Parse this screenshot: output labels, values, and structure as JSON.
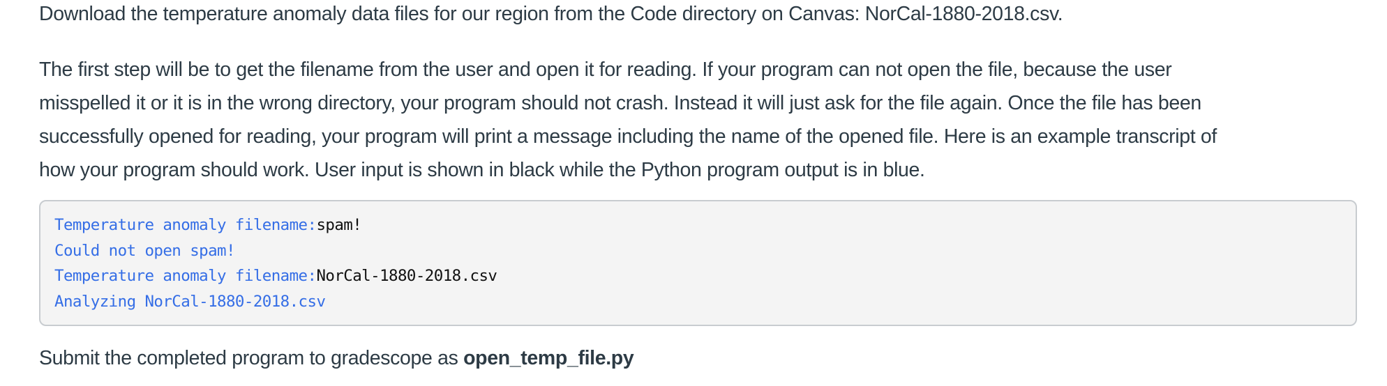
{
  "intro": "Download the temperature anomaly data files for our region from the Code directory on Canvas: NorCal-1880-2018.csv.",
  "instructions_lines": [
    "The first step will be to get the filename from the user and open it for reading. If your program can not open the file, because the user",
    "misspelled it or it is in the wrong directory, your program should not crash. Instead it will just ask for the file again. Once the file has been",
    "successfully opened for reading, your program will print a message including the name of the opened file. Here is an example transcript of",
    "how your program should work. User input is shown in black while the Python program output is in blue."
  ],
  "transcript": [
    {
      "output": "Temperature anomaly filename:",
      "input": "spam!"
    },
    {
      "output": "Could not open spam!",
      "input": ""
    },
    {
      "output": "Temperature anomaly filename:",
      "input": "NorCal-1880-2018.csv"
    },
    {
      "output": "Analyzing NorCal-1880-2018.csv",
      "input": ""
    }
  ],
  "submit": {
    "text": "Submit the completed program to gradescope as ",
    "filename": "open_temp_file.py"
  },
  "colors": {
    "body_text": "#2d3b45",
    "program_output": "#356ee6",
    "user_input": "#111111",
    "code_background": "#f4f4f4",
    "code_border": "#c8ccd0"
  }
}
